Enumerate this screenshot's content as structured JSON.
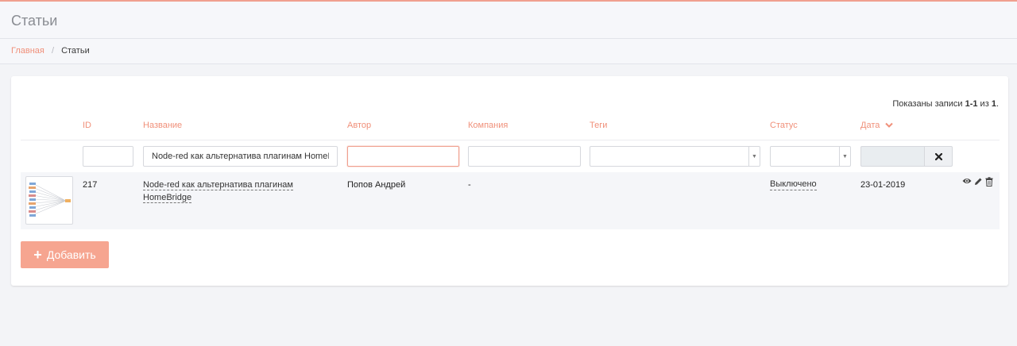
{
  "page": {
    "title": "Статьи",
    "accent_color": "#f0907a"
  },
  "breadcrumb": {
    "home": "Главная",
    "separator": "/",
    "current": "Статьи"
  },
  "summary": {
    "prefix": "Показаны записи ",
    "range": "1-1",
    "middle": " из ",
    "total": "1",
    "suffix": "."
  },
  "table": {
    "columns": {
      "id": "ID",
      "title": "Название",
      "author": "Автор",
      "company": "Компания",
      "tags": "Теги",
      "status": "Статус",
      "date": "Дата"
    },
    "filters": {
      "id": "",
      "title": "Node-red как альтернатива плагинам HomeI",
      "author": "",
      "company": "",
      "tags": "",
      "status": "",
      "date": ""
    },
    "rows": [
      {
        "id": "217",
        "title": "Node-red как альтернатива плагинам HomeBridge",
        "author": "Попов Андрей",
        "company": "-",
        "status": "Выключено",
        "date": "23-01-2019"
      }
    ]
  },
  "buttons": {
    "add": "Добавить"
  },
  "icons": {
    "sort": "chevron-down-icon",
    "clear": "close-icon",
    "view": "eye-icon",
    "edit": "pencil-icon",
    "delete": "trash-icon",
    "add": "plus-icon"
  }
}
